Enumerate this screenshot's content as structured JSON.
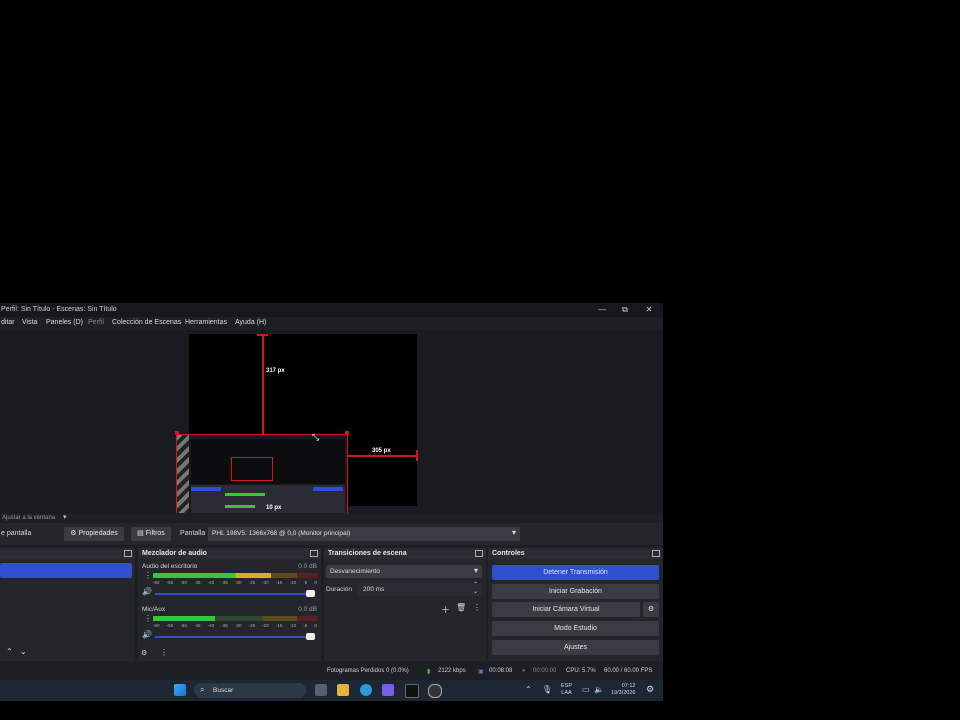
{
  "window": {
    "title": "Perfil: Sin Título - Escenas: Sin Título",
    "minimize": "—",
    "maximize": "⧉",
    "close": "✕"
  },
  "menu": [
    "ditar",
    "Vista",
    "Paneles (D)",
    "Perfil",
    "Colección de Escenas",
    "Herramientas",
    "Ayuda (H)"
  ],
  "preview": {
    "top_distance": "317 px",
    "right_distance": "305 px",
    "bottom_distance": "10 px",
    "fit_window": "Ajustar a la ventana"
  },
  "source_bar": {
    "source_name": "e pantalla",
    "properties": "Propiedades",
    "filters": "Filtros",
    "screen_label": "Pantalla",
    "screen_value": "PHL 198V5: 1366x768 @ 0,0 (Monitor principal)"
  },
  "mixer": {
    "title": "Mezclador de audio",
    "channels": [
      {
        "name": "Audio del escritorio",
        "db": "0.0 dB",
        "level": 0.72
      },
      {
        "name": "Mic/Aux",
        "db": "0.0 dB",
        "level": 0.38
      }
    ],
    "scale": [
      "-60",
      "-55",
      "-50",
      "-45",
      "-40",
      "-35",
      "-30",
      "-25",
      "-20",
      "-15",
      "-10",
      "-5",
      "0"
    ]
  },
  "transitions": {
    "title": "Transiciones de escena",
    "selected": "Desvanecimiento",
    "duration_label": "Duración",
    "duration_value": "200 ms"
  },
  "controls": {
    "title": "Controles",
    "stop_stream": "Detener Transmisión",
    "start_recording": "Iniciar Grabación",
    "start_virtual_cam": "Iniciar Cámara Virtual",
    "studio_mode": "Modo Estudio",
    "settings": "Ajustes",
    "accent": "#2f4fd3"
  },
  "status": {
    "dropped_frames": "Fotogramas Perdidos 0 (0.0%)",
    "bitrate": "2122 kbps",
    "stream_time": "00:08:08",
    "rec_time": "00:00:00",
    "cpu": "CPU: 5.7%",
    "fps": "60.00 / 60.00 FPS"
  },
  "taskbar": {
    "search_placeholder": "Buscar",
    "lang_top": "ESP",
    "lang_bottom": "LAA",
    "time": "07:12",
    "date": "19/3/2026"
  }
}
